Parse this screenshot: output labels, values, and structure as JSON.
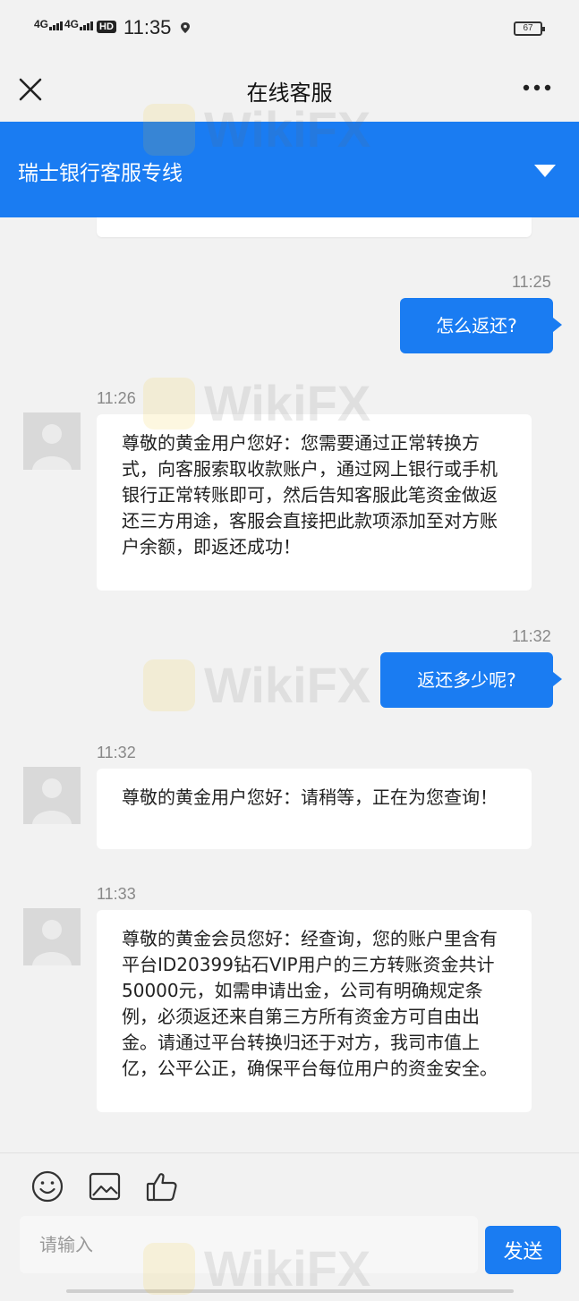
{
  "status_bar": {
    "signal_1": "4G",
    "signal_2": "4G",
    "hd": "HD",
    "time": "11:35",
    "battery": "67"
  },
  "header": {
    "title": "在线客服",
    "close_icon": "close-icon",
    "more_icon": "more-icon"
  },
  "channel": {
    "name": "瑞士银行客服专线",
    "toggle_icon": "triangle-down-icon"
  },
  "messages": [
    {
      "direction": "outgoing",
      "time": "11:25",
      "text": "怎么返还?"
    },
    {
      "direction": "incoming",
      "time": "11:26",
      "text": "尊敬的黄金用户您好：您需要通过正常转换方式，向客服索取收款账户，通过网上银行或手机银行正常转账即可，然后告知客服此笔资金做返还三方用途，客服会直接把此款项添加至对方账户余额，即返还成功！"
    },
    {
      "direction": "outgoing",
      "time": "11:32",
      "text": "返还多少呢?"
    },
    {
      "direction": "incoming",
      "time": "11:32",
      "text": "尊敬的黄金用户您好：请稍等，正在为您查询！"
    },
    {
      "direction": "incoming",
      "time": "11:33",
      "text": "尊敬的黄金会员您好：经查询，您的账户里含有平台ID20399钻石VIP用户的三方转账资金共计50000元，如需申请出金，公司有明确规定条例，必须返还来自第三方所有资金方可自由出金。请通过平台转换归还于对方，我司市值上亿，公平公正，确保平台每位用户的资金安全。"
    }
  ],
  "composer": {
    "placeholder": "请输入",
    "value": "",
    "send_label": "发送",
    "tools": [
      "emoji-icon",
      "image-icon",
      "thumbs-up-icon"
    ]
  },
  "watermark": {
    "text": "WikiFX"
  },
  "colors": {
    "accent": "#1a7cf2",
    "background": "#f2f2f2",
    "bubble_in": "#ffffff"
  }
}
